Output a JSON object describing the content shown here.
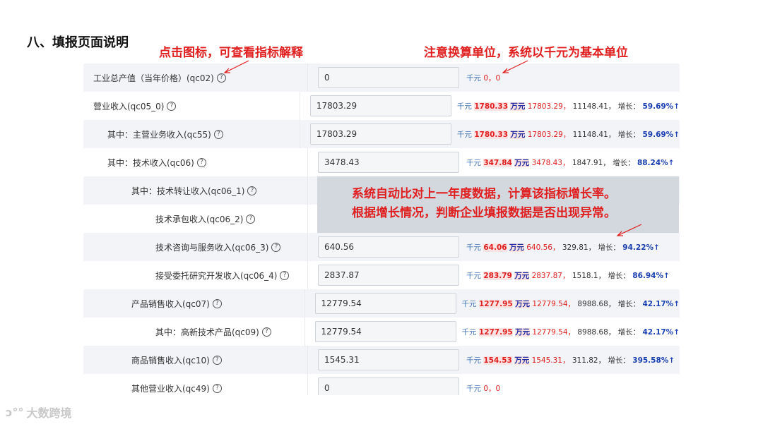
{
  "title": "八、填报页面说明",
  "notes": {
    "icon_hint": "点击图标，可查看指标解释",
    "unit_hint": "注意换算单位，系统以千元为基本单位",
    "growth_hint_1": "系统自动比对上一年度数据，计算该指标增长率。",
    "growth_hint_2": "根据增长情况，判断企业填报数据是否出现异常。"
  },
  "help_icon": "question-circle-icon",
  "rows": [
    {
      "label": "工业总产值（当年价格）(qc02)",
      "value": "0",
      "unit": "千元",
      "plain": "0，0"
    },
    {
      "label": "营业收入(qc05_0)",
      "value": "17803.29",
      "unit": "千元",
      "wan_val": "1780.33",
      "wan_unit": "万元",
      "cur": "17803.29，",
      "prev": "11148.41，",
      "growth_label": "增长：",
      "rate": "59.69%↑"
    },
    {
      "label": "其中：主营业务收入(qc55)",
      "value": "17803.29",
      "unit": "千元",
      "wan_val": "1780.33",
      "wan_unit": "万元",
      "cur": "17803.29，",
      "prev": "11148.41，",
      "growth_label": "增长：",
      "rate": "59.69%↑"
    },
    {
      "label": "其中：技术收入(qc06)",
      "value": "3478.43",
      "unit": "千元",
      "wan_val": "347.84",
      "wan_unit": "万元",
      "cur": "3478.43，",
      "prev": "1847.91，",
      "growth_label": "增长：",
      "rate": "88.24%↑"
    },
    {
      "label": "其中：技术转让收入(qc06_1)"
    },
    {
      "label": "技术承包收入(qc06_2)"
    },
    {
      "label": "技术咨询与服务收入(qc06_3)",
      "value": "640.56",
      "unit": "千元",
      "wan_val": "64.06",
      "wan_unit": "万元",
      "cur": "640.56，",
      "prev": "329.81，",
      "growth_label": "增长：",
      "rate": "94.22%↑"
    },
    {
      "label": "接受委托研究开发收入(qc06_4)",
      "value": "2837.87",
      "unit": "千元",
      "wan_val": "283.79",
      "wan_unit": "万元",
      "cur": "2837.87，",
      "prev": "1518.1，",
      "growth_label": "增长：",
      "rate": "86.94%↑"
    },
    {
      "label": "产品销售收入(qc07)",
      "value": "12779.54",
      "unit": "千元",
      "wan_val": "1277.95",
      "wan_unit": "万元",
      "cur": "12779.54，",
      "prev": "8988.68，",
      "growth_label": "增长：",
      "rate": "42.17%↑"
    },
    {
      "label": "其中：高新技术产品(qc09)",
      "value": "12779.54",
      "unit": "千元",
      "wan_val": "1277.95",
      "wan_unit": "万元",
      "cur": "12779.54，",
      "prev": "8988.68，",
      "growth_label": "增长：",
      "rate": "42.17%↑"
    },
    {
      "label": "商品销售收入(qc10)",
      "value": "1545.31",
      "unit": "千元",
      "wan_val": "154.53",
      "wan_unit": "万元",
      "cur": "1545.31，",
      "prev": "311.82，",
      "growth_label": "增长：",
      "rate": "395.58%↑"
    },
    {
      "label": "其他营业收入(qc49)",
      "value": "0",
      "unit": "千元",
      "plain": "0，0"
    }
  ],
  "watermark": "大数跨境",
  "colors": {
    "annotation": "#e02020",
    "rate": "#1a3fb0",
    "stripe": "#f2f4f7",
    "gray_box": "#d3d7de"
  }
}
